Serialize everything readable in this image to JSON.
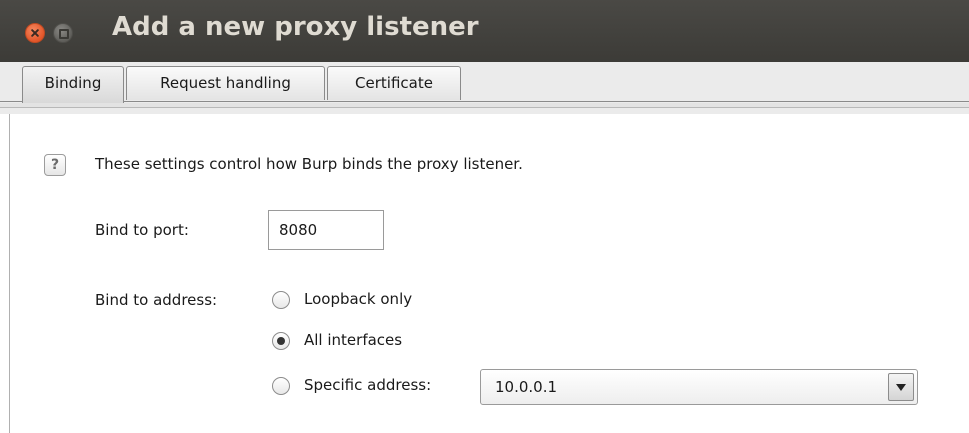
{
  "window": {
    "title": "Add a new proxy listener"
  },
  "tabs": [
    {
      "label": "Binding",
      "active": true
    },
    {
      "label": "Request handling",
      "active": false
    },
    {
      "label": "Certificate",
      "active": false
    }
  ],
  "binding": {
    "help_icon": "question-mark",
    "description": "These settings control how Burp binds the proxy listener.",
    "port_label": "Bind to port:",
    "port_value": "8080",
    "address_label": "Bind to address:",
    "options": [
      {
        "label": "Loopback only",
        "selected": false
      },
      {
        "label": "All interfaces",
        "selected": true
      },
      {
        "label": "Specific address:",
        "selected": false
      }
    ],
    "specific_address_value": "10.0.0.1"
  },
  "colors": {
    "titlebar": "#3c3b37",
    "close_button": "#e2562a"
  }
}
